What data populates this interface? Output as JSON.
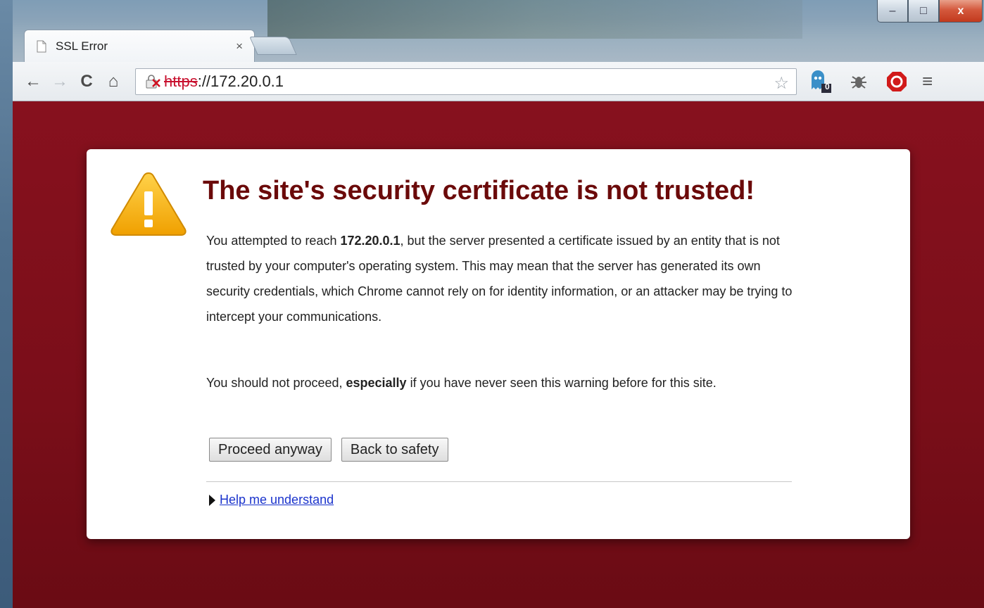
{
  "window": {
    "controls": {
      "minimize": "–",
      "maximize": "□",
      "close": "x"
    }
  },
  "tab": {
    "title": "SSL Error",
    "close": "×"
  },
  "toolbar": {
    "back": "←",
    "forward": "→",
    "reload": "C",
    "home": "⌂",
    "url_scheme": "https",
    "url_rest": "://172.20.0.1",
    "star": "☆",
    "extension_badge": "0",
    "menu": "≡"
  },
  "page": {
    "heading": "The site's security certificate is not trusted!",
    "p1_before": "You attempted to reach ",
    "p1_host": "172.20.0.1",
    "p1_after": ", but the server presented a certificate issued by an entity that is not trusted by your computer's operating system. This may mean that the server has generated its own security credentials, which Chrome cannot rely on for identity information, or an attacker may be trying to intercept your communications.",
    "p2_before": "You should not proceed, ",
    "p2_bold": "especially",
    "p2_after": " if you have never seen this warning before for this site.",
    "proceed_label": "Proceed anyway",
    "back_label": "Back to safety",
    "help_link": "Help me understand"
  },
  "colors": {
    "page_bg": "#87111e",
    "heading": "#6b0a0a",
    "link": "#1a33cc",
    "url_error": "#c8102e"
  }
}
